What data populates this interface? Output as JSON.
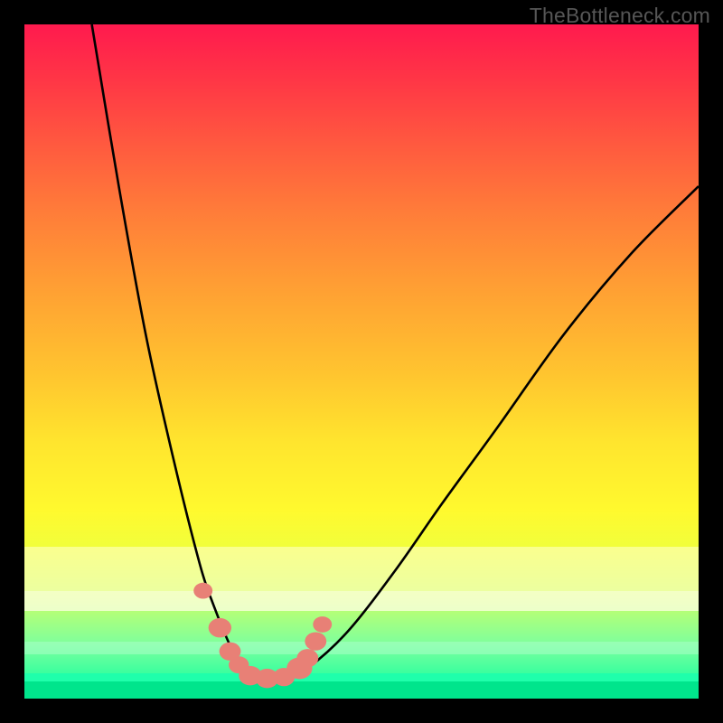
{
  "watermark": "TheBottleneck.com",
  "chart_data": {
    "type": "line",
    "title": "",
    "xlabel": "",
    "ylabel": "",
    "xlim": [
      0,
      100
    ],
    "ylim": [
      0,
      100
    ],
    "background": "rainbow-gradient",
    "series": [
      {
        "name": "bottleneck-curve",
        "x": [
          10,
          14,
          18,
          22,
          26,
          28,
          30,
          31.5,
          33,
          34.5,
          36,
          39,
          42,
          48,
          55,
          62,
          70,
          80,
          90,
          100
        ],
        "y": [
          100,
          76,
          54,
          36,
          20,
          14,
          9,
          6,
          4.2,
          3.2,
          3.0,
          3.2,
          4.5,
          10,
          19,
          29,
          40,
          54,
          66,
          76
        ]
      }
    ],
    "markers": [
      {
        "x": 26.5,
        "y": 16,
        "r": 1.4
      },
      {
        "x": 29.0,
        "y": 10.5,
        "r": 1.7
      },
      {
        "x": 30.5,
        "y": 7,
        "r": 1.6
      },
      {
        "x": 31.8,
        "y": 5,
        "r": 1.5
      },
      {
        "x": 33.5,
        "y": 3.4,
        "r": 1.7
      },
      {
        "x": 36.0,
        "y": 3.0,
        "r": 1.7
      },
      {
        "x": 38.5,
        "y": 3.2,
        "r": 1.6
      },
      {
        "x": 40.8,
        "y": 4.5,
        "r": 1.9
      },
      {
        "x": 42.0,
        "y": 6.0,
        "r": 1.6
      },
      {
        "x": 43.2,
        "y": 8.5,
        "r": 1.6
      },
      {
        "x": 44.2,
        "y": 11.0,
        "r": 1.4
      }
    ]
  },
  "colors": {
    "frame": "#000000",
    "curve": "#000000",
    "marker": "#e88076",
    "green": "#00e58c"
  }
}
